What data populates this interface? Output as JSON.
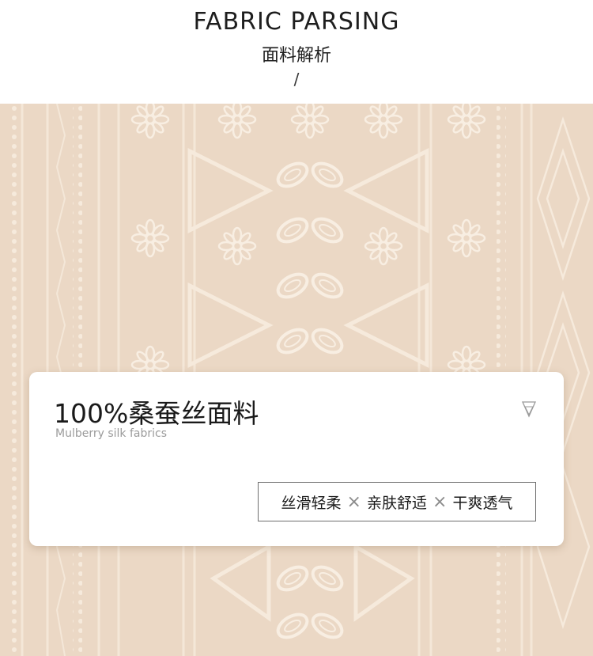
{
  "header": {
    "title_en": "FABRIC PARSING",
    "title_cn": "面料解析",
    "divider": "/"
  },
  "card": {
    "title": "100%桑蚕丝面料",
    "subtitle": "Mulberry silk fabrics",
    "icon": "double-triangle-down-icon",
    "tags": [
      "丝滑轻柔",
      "亲肤舒适",
      "干爽透气"
    ],
    "separator": "×"
  },
  "colors": {
    "fabric": "#e9d6c2",
    "embroidery": "#f7ecdf",
    "text": "#1a1a1a"
  }
}
